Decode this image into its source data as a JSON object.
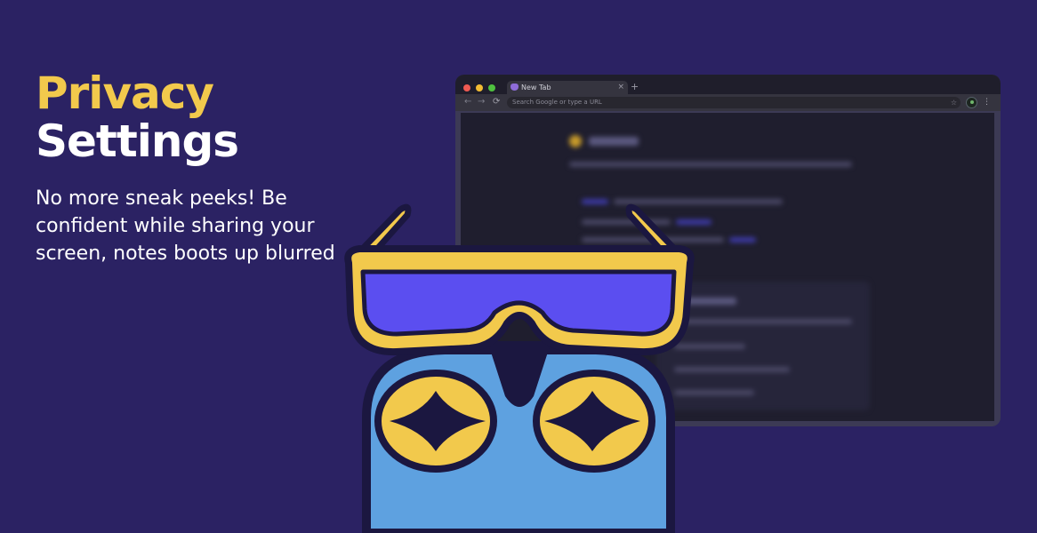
{
  "hero": {
    "title_line1": "Privacy",
    "title_line2": "Settings",
    "description": "No more sneak peeks! Be confident while sharing your screen, notes boots up blurred"
  },
  "browser": {
    "tab_title": "New Tab",
    "tab_close": "×",
    "new_tab": "+",
    "omnibox_placeholder": "Search Google or type a URL",
    "nav_back": "←",
    "nav_forward": "→",
    "nav_reload": "⟳",
    "bookmark_star": "☆",
    "menu": "⋮"
  },
  "colors": {
    "background": "#2b2263",
    "title_accent": "#f2c94c",
    "owl_body": "#5ea1e0",
    "owl_eye": "#f2c94c",
    "glasses_frame": "#f2c94c",
    "glasses_lens": "#5b4ef0",
    "outline": "#1b1740"
  },
  "icons": {
    "mascot": "owl-with-sunglasses",
    "tab_favicon": "brain-icon",
    "profile": "avatar-icon"
  }
}
